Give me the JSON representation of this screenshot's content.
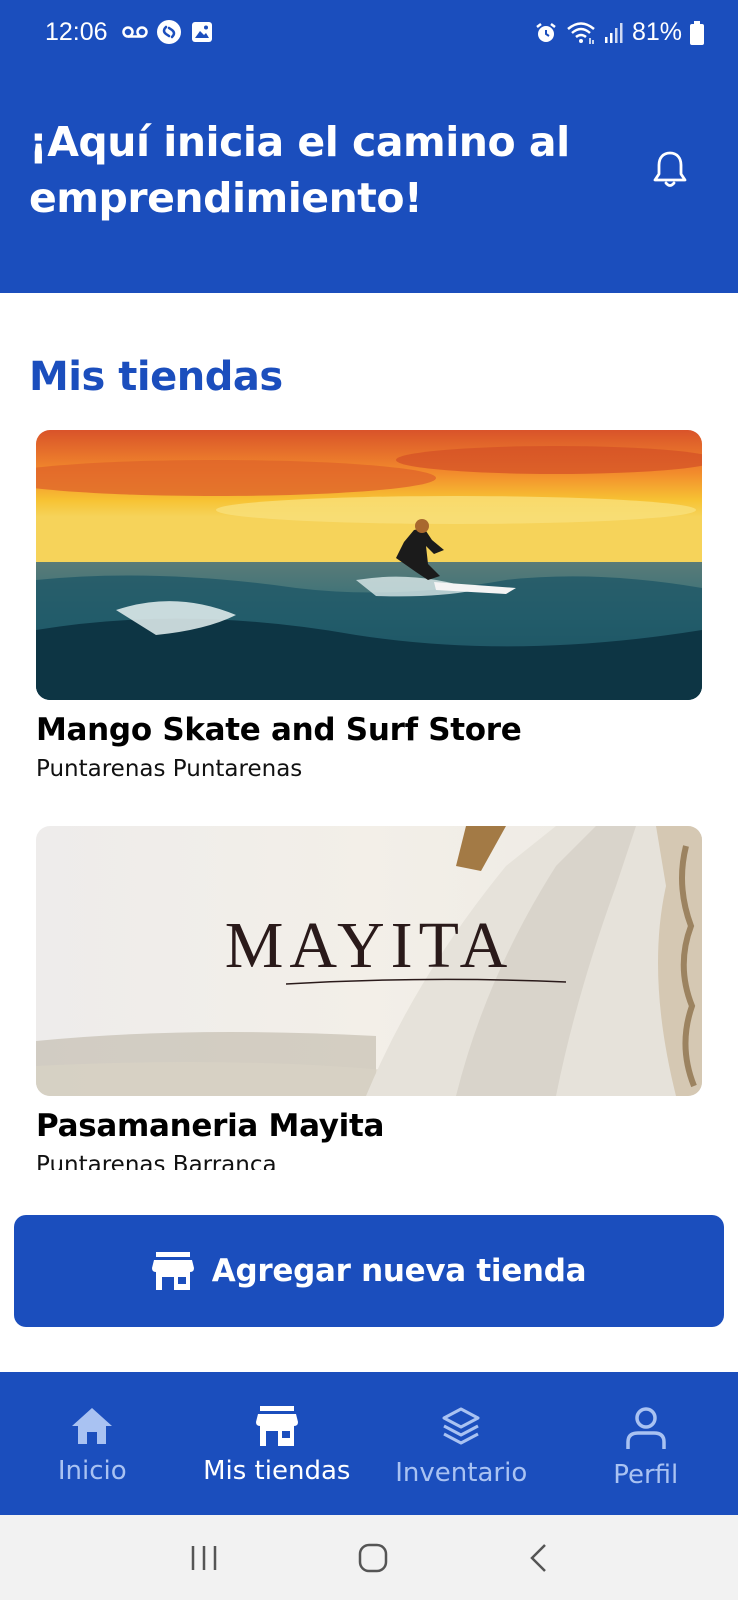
{
  "status_bar": {
    "time": "12:06",
    "battery": "81%",
    "icons": [
      "voicemail-icon",
      "shazam-icon",
      "gallery-icon",
      "alarm-icon",
      "wifi-icon",
      "signal-icon",
      "battery-icon"
    ]
  },
  "header": {
    "title": "¡Aquí inicia el camino al emprendimiento!",
    "notification_icon": "bell-icon"
  },
  "main": {
    "section_title": "Mis tiendas",
    "stores": [
      {
        "name": "Mango Skate and Surf Store",
        "location": "Puntarenas Puntarenas",
        "image": "surfer-sunset-photo"
      },
      {
        "name": "Pasamaneria Mayita",
        "location": "Puntarenas Barranca",
        "image": "mayita-logo-photo",
        "logo_text": "MAYITA"
      }
    ],
    "add_button": {
      "label": "Agregar nueva tienda",
      "icon": "store-icon"
    }
  },
  "bottom_nav": {
    "items": [
      {
        "label": "Inicio",
        "icon": "home-icon",
        "active": false
      },
      {
        "label": "Mis tiendas",
        "icon": "store-icon",
        "active": true
      },
      {
        "label": "Inventario",
        "icon": "layers-icon",
        "active": false
      },
      {
        "label": "Perfil",
        "icon": "user-icon",
        "active": false
      }
    ]
  },
  "system_nav": {
    "buttons": [
      "recents-button",
      "home-button",
      "back-button"
    ]
  },
  "colors": {
    "primary": "#1b4ebd",
    "nav_inactive": "#a9c2f2",
    "text": "#000000"
  }
}
